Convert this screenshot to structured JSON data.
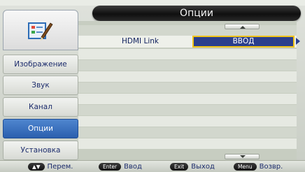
{
  "title": "Опции",
  "sidebar": {
    "logo_icon": "settings-checklist-pencil-icon",
    "items": [
      {
        "label": "Изображение",
        "active": false
      },
      {
        "label": "Звук",
        "active": false
      },
      {
        "label": "Канал",
        "active": false
      },
      {
        "label": "Опции",
        "active": true
      },
      {
        "label": "Установка",
        "active": false
      }
    ]
  },
  "main": {
    "setting": {
      "label": "HDMI Link",
      "value": "ВВОД"
    },
    "scroll_up_icon": "triangle-up-icon",
    "scroll_down_icon": "triangle-down-icon"
  },
  "hints": [
    {
      "key": "▲▼",
      "text": "Перем."
    },
    {
      "key": "Enter",
      "text": "Ввод"
    },
    {
      "key": "Exit",
      "text": "Выход"
    },
    {
      "key": "Menu",
      "text": "Возвр."
    }
  ],
  "colors": {
    "accent_blue": "#2b5fae",
    "value_bg": "#2b3f8c",
    "focus_border": "#f0c419",
    "text": "#1c2c6c"
  }
}
